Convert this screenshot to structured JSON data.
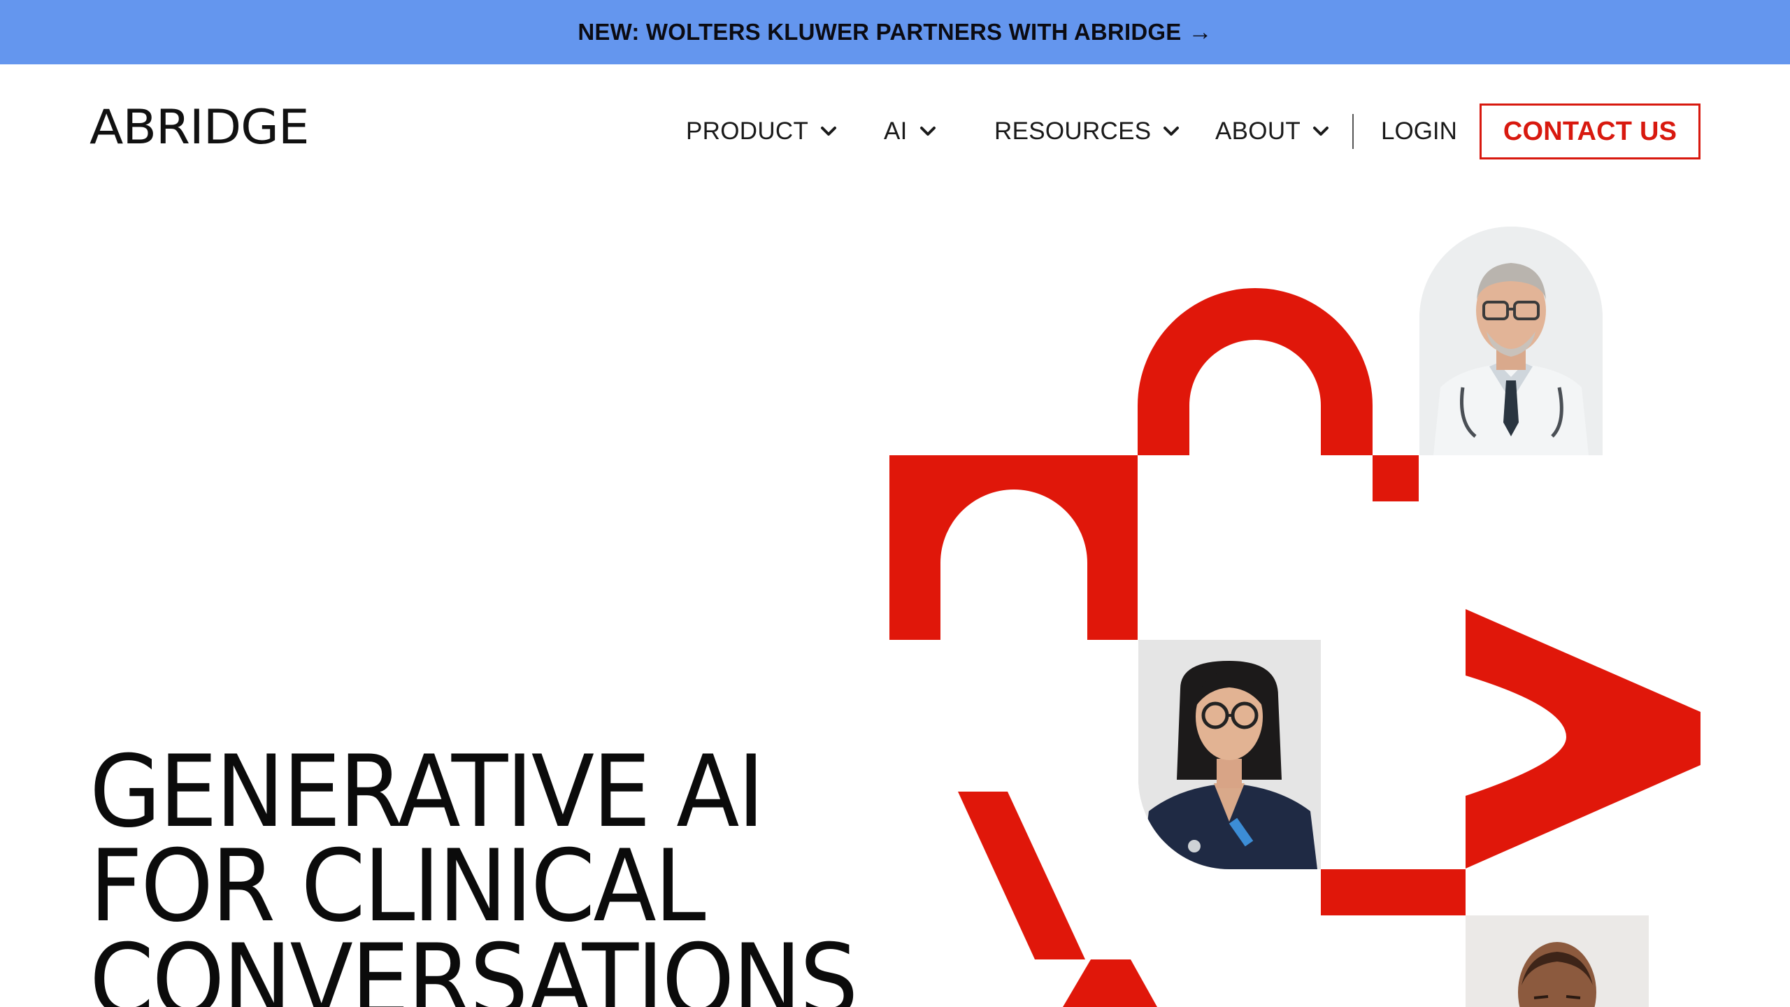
{
  "announcement": {
    "text": "NEW: WOLTERS KLUWER PARTNERS WITH ABRIDGE",
    "arrow": "→"
  },
  "header": {
    "logo": "ABRIDGE",
    "nav": [
      {
        "label": "PRODUCT",
        "icon": "chevron-down-icon"
      },
      {
        "label": "AI",
        "icon": "chevron-down-icon"
      },
      {
        "label": "RESOURCES",
        "icon": "chevron-down-icon"
      },
      {
        "label": "ABOUT",
        "icon": "chevron-down-icon"
      }
    ],
    "login": "LOGIN",
    "contact": "CONTACT US"
  },
  "hero": {
    "title_lines": [
      "GENERATIVE AI",
      "FOR CLINICAL",
      "CONVERSATIONS"
    ]
  },
  "colors": {
    "announcement_bg": "#6496ee",
    "brand_red": "#e0170a",
    "text": "#111111"
  }
}
